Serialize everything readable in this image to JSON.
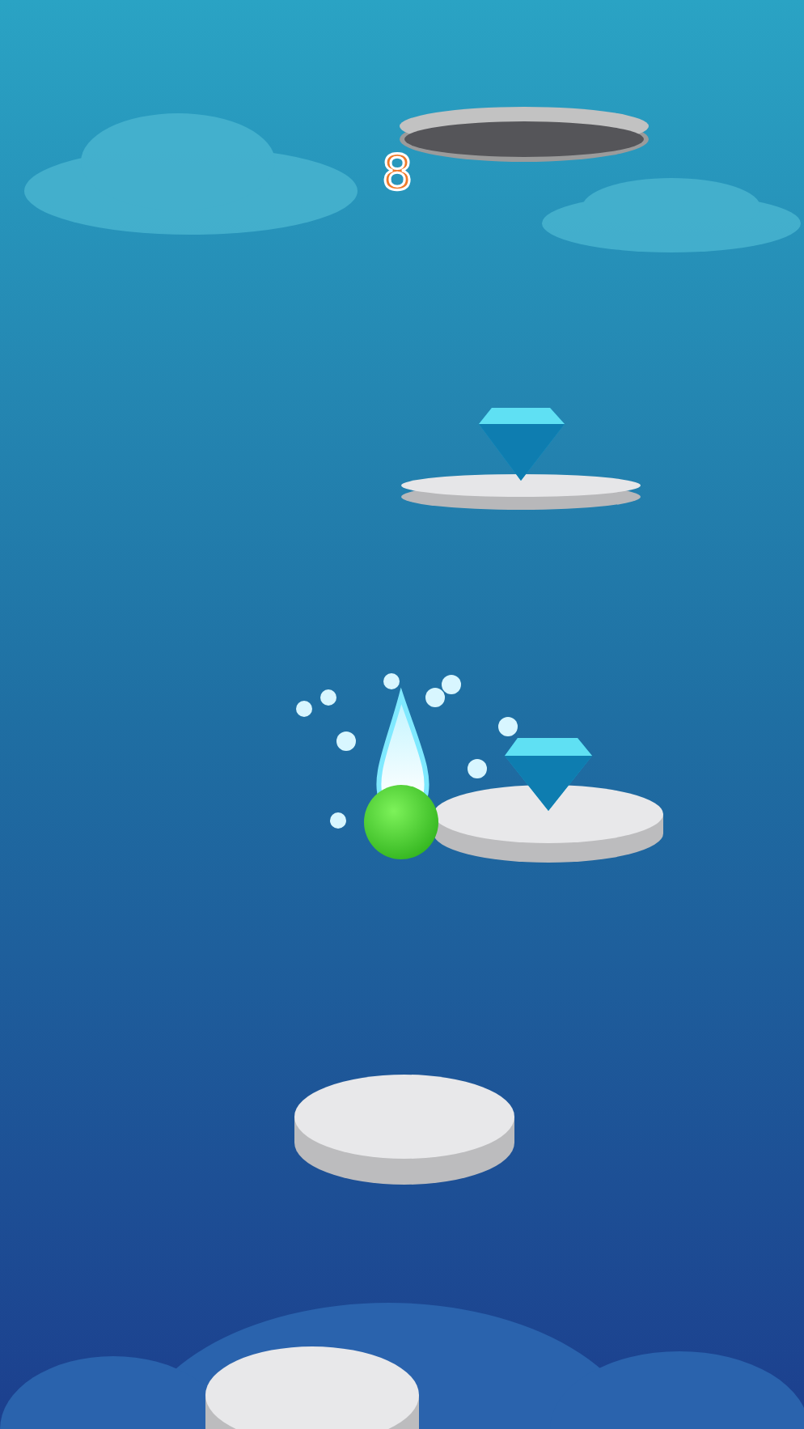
{
  "score": "8"
}
